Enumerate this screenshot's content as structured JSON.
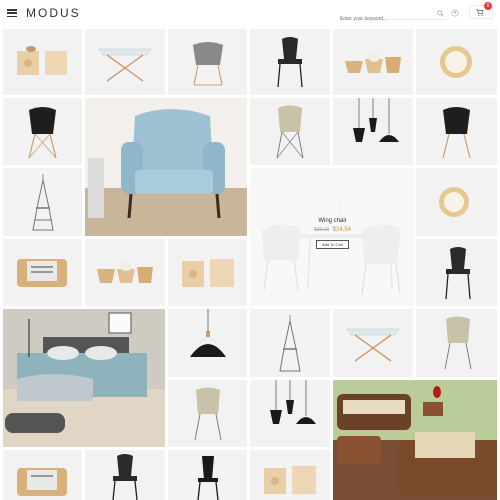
{
  "header": {
    "logo": "MODUS",
    "search_placeholder": "Enter your keyword...",
    "cart_count": "0"
  },
  "featured_product": {
    "name": "Wing chair",
    "old_price": "$30.00",
    "price": "$24.54",
    "add_to_cart": "Add To Cart"
  },
  "colors": {
    "accent": "#d98a3c",
    "badge": "#e53935",
    "tile_bg": "#f2f2f2"
  },
  "products": [
    "box-speaker",
    "glass-table",
    "grey-shell-chair",
    "black-chair",
    "wooden-bowls",
    "ring-mirror",
    "black-eames-chair",
    "blue-armchair",
    "beige-chair",
    "black-pendant-lamps",
    "black-eames-chair",
    "eiffel-tower-model",
    "wing-chair",
    "ring-mirror",
    "wooden-tray",
    "wooden-bowls",
    "box-speaker",
    "black-chair",
    "bedroom-scene",
    "black-pendant-lamp",
    "eiffel-tower-model",
    "glass-table",
    "beige-chair",
    "beige-chair",
    "black-pendant-lamps",
    "rattan-patio-set",
    "wooden-tray",
    "black-chair",
    "black-chair-tall",
    "box-speaker"
  ]
}
